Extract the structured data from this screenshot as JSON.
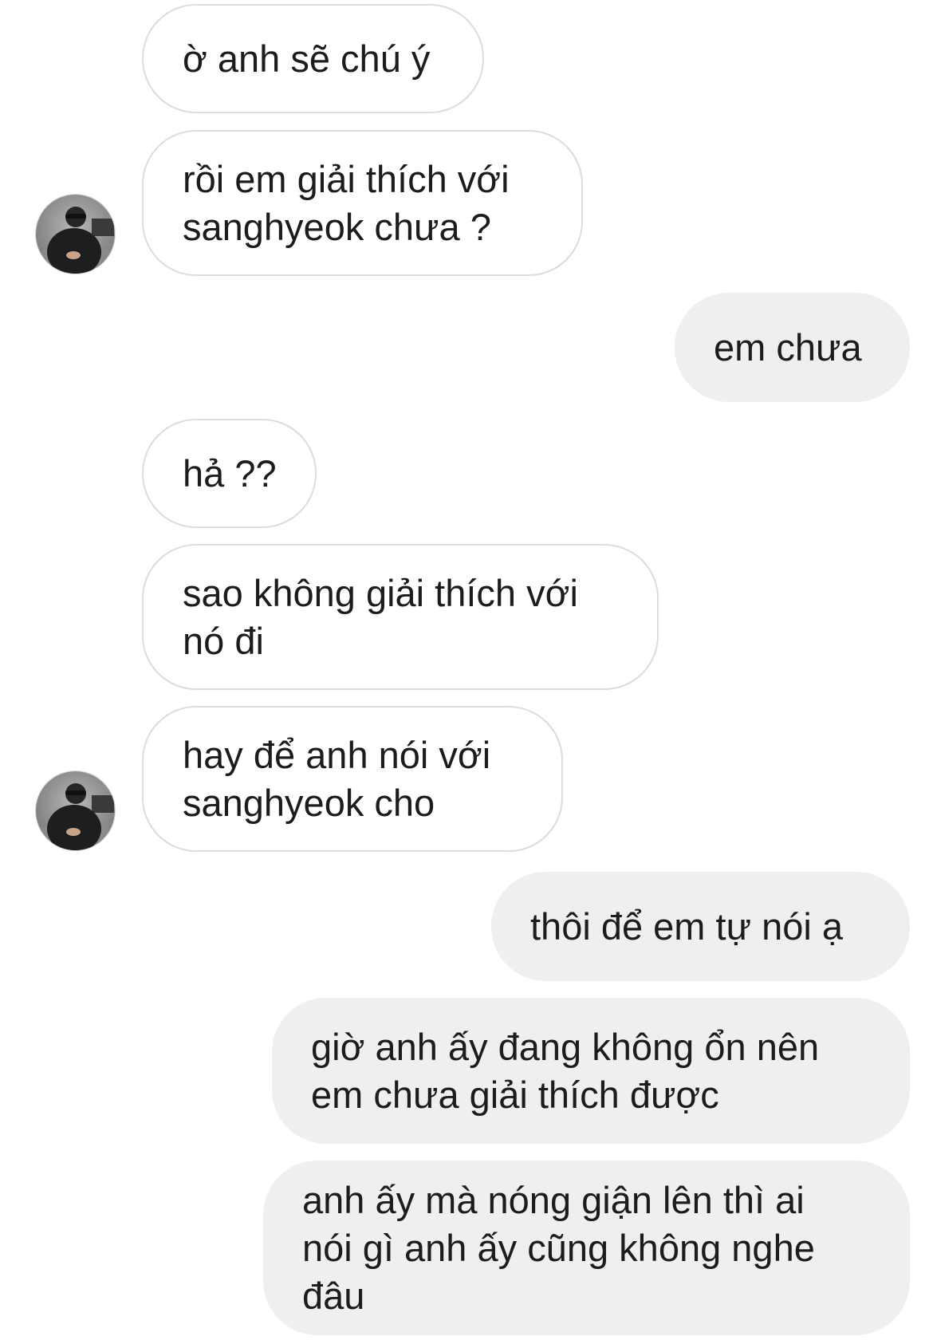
{
  "conversation": {
    "messages": [
      {
        "sender": "other",
        "text": "ờ anh sẽ chú ý"
      },
      {
        "sender": "other",
        "text": "rồi em giải thích với\nsanghyeok chưa ?"
      },
      {
        "sender": "me",
        "text": "em chưa"
      },
      {
        "sender": "other",
        "text": "hả ??"
      },
      {
        "sender": "other",
        "text": "sao không giải thích với\nnó đi"
      },
      {
        "sender": "other",
        "text": "hay để anh nói với\nsanghyeok cho"
      },
      {
        "sender": "me",
        "text": "thôi để em tự nói ạ"
      },
      {
        "sender": "me",
        "text": "giờ anh ấy đang không ổn nên\nem chưa giải thích được"
      },
      {
        "sender": "me",
        "text": "anh ấy mà nóng giận lên thì ai\nnói gì anh ấy cũng không nghe\nđâu"
      }
    ]
  },
  "avatar_icon": "profile-photo",
  "colors": {
    "received_bubble_bg": "#ffffff",
    "received_bubble_border": "#dcdcdc",
    "sent_bubble_bg": "#efefef",
    "text": "#1c1c1c"
  }
}
